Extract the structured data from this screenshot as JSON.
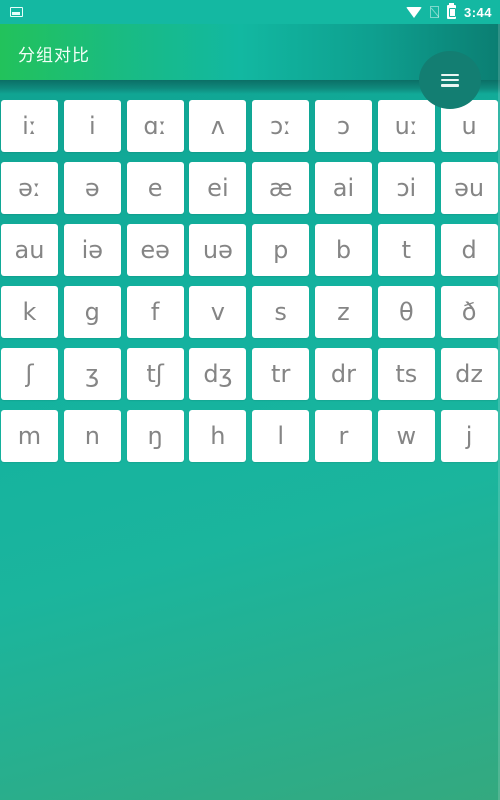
{
  "status_bar": {
    "left_icon": "image-notification-icon",
    "icons": [
      "wifi-icon",
      "no-sim-icon",
      "battery-charging-icon"
    ],
    "time": "3:44"
  },
  "app_bar": {
    "title": "分组对比",
    "menu_button_icon": "menu-icon"
  },
  "colors": {
    "status_bar": "#14b8a2",
    "app_bar_start": "#22c25b",
    "app_bar_end": "#0b7e72",
    "menu_button": "#137e72",
    "tile_background": "#ffffff",
    "tile_text": "#858585",
    "background_start": "#0f9f8e",
    "background_end": "#34a97f"
  },
  "phonemes": [
    [
      "iː",
      "i",
      "ɑː",
      "ʌ",
      "ɔː",
      "ɔ",
      "uː",
      "u"
    ],
    [
      "əː",
      "ə",
      "e",
      "ei",
      "æ",
      "ai",
      "ɔi",
      "əu"
    ],
    [
      "au",
      "iə",
      "eə",
      "uə",
      "p",
      "b",
      "t",
      "d"
    ],
    [
      "k",
      "g",
      "f",
      "v",
      "s",
      "z",
      "θ",
      "ð"
    ],
    [
      "ʃ",
      "ʒ",
      "tʃ",
      "dʒ",
      "tr",
      "dr",
      "ts",
      "dz"
    ],
    [
      "m",
      "n",
      "ŋ",
      "h",
      "l",
      "r",
      "w",
      "j"
    ]
  ]
}
